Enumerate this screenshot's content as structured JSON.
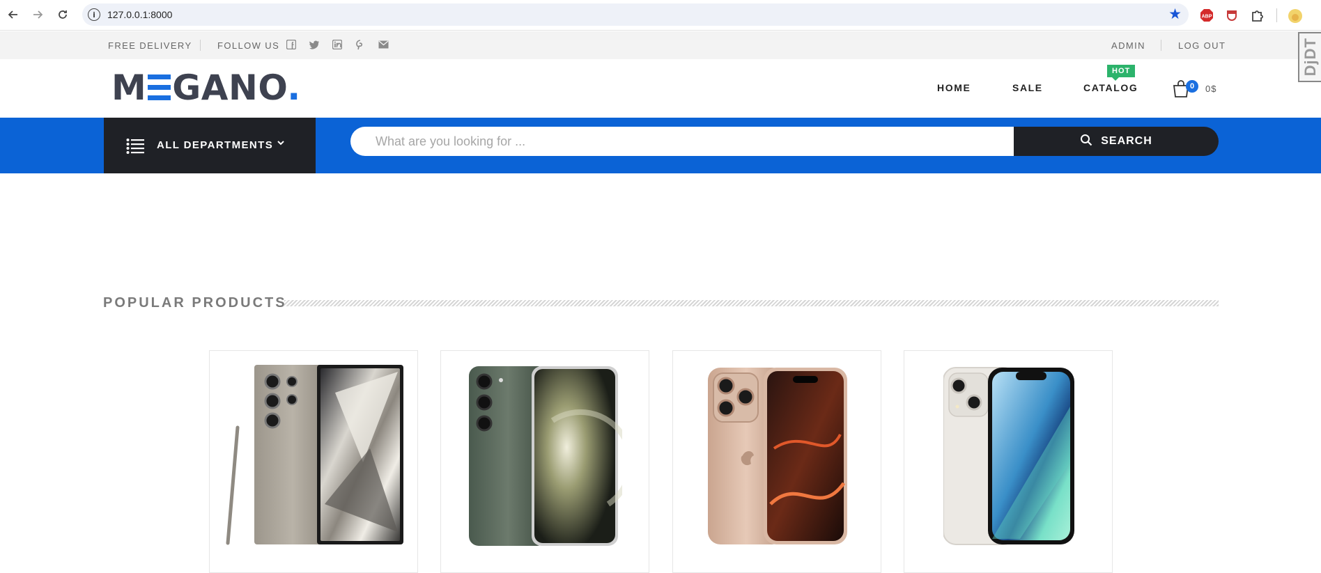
{
  "browser": {
    "url": "127.0.0.1:8000",
    "icons": [
      "back-icon",
      "forward-icon",
      "reload-icon",
      "site-info-icon",
      "bookmark-star-icon",
      "adblock-icon",
      "extension-shield-icon",
      "extensions-puzzle-icon",
      "profile-avatar-icon"
    ],
    "adblock_label": "ABP"
  },
  "topbar": {
    "free_delivery": "FREE DELIVERY",
    "follow_us": "FOLLOW US",
    "social_icons": [
      "facebook-icon",
      "twitter-icon",
      "linkedin-icon",
      "pinterest-icon",
      "mail-icon"
    ],
    "admin": "ADMIN",
    "logout": "LOG OUT"
  },
  "header": {
    "logo": {
      "part1": "M",
      "part2": "GANO",
      "dot": "."
    },
    "nav": [
      {
        "label": "HOME"
      },
      {
        "label": "SALE"
      },
      {
        "label": "CATALOG",
        "badge": "HOT"
      }
    ],
    "cart": {
      "count": "0",
      "total": "0$"
    }
  },
  "search_band": {
    "departments_label": "ALL DEPARTMENTS",
    "search_placeholder": "What are you looking for ...",
    "search_button": "SEARCH"
  },
  "popular": {
    "title": "POPULAR PRODUCTS",
    "products": [
      {
        "image": "samsung-galaxy-s24-ultra-titanium"
      },
      {
        "image": "samsung-galaxy-s23-green"
      },
      {
        "image": "iphone-16-pro-desert"
      },
      {
        "image": "iphone-13-starlight"
      }
    ]
  },
  "debug_toolbar": {
    "label": "DjDT"
  },
  "colors": {
    "accent_blue": "#0b63d6",
    "dark": "#1f2126",
    "hot_green": "#2cb36b",
    "topbar_bg": "#f3f3f3"
  }
}
